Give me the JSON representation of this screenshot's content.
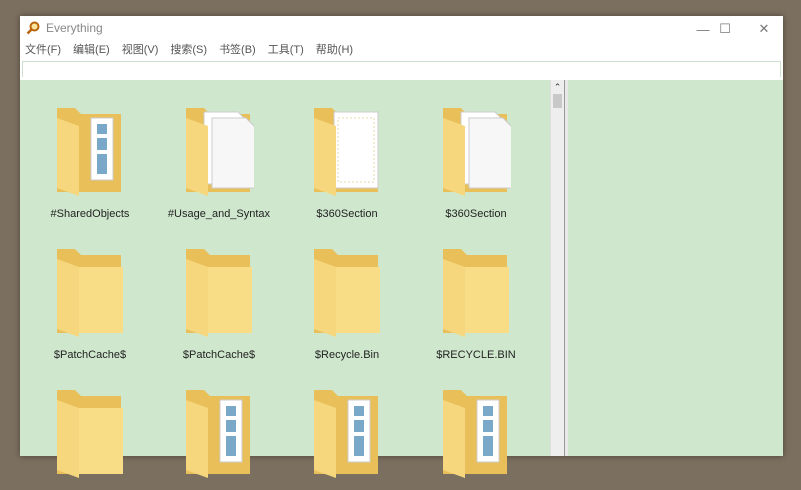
{
  "window": {
    "title": "Everything",
    "minimize": "—",
    "maximize": "☐",
    "close": "✕"
  },
  "menu": [
    "文件(F)",
    "编辑(E)",
    "视图(V)",
    "搜索(S)",
    "书签(B)",
    "工具(T)",
    "帮助(H)"
  ],
  "search": {
    "value": "",
    "placeholder": ""
  },
  "scrollbar": {
    "up_arrow": "⌃"
  },
  "items": [
    {
      "name": "#SharedObjects",
      "icon": "folder-docs"
    },
    {
      "name": "#Usage_and_Syntax",
      "icon": "folder-papers"
    },
    {
      "name": "$360Section",
      "icon": "folder-paper"
    },
    {
      "name": "$360Section",
      "icon": "folder-papers"
    },
    {
      "name": "$PatchCache$",
      "icon": "folder-empty"
    },
    {
      "name": "$PatchCache$",
      "icon": "folder-empty"
    },
    {
      "name": "$Recycle.Bin",
      "icon": "folder-empty"
    },
    {
      "name": "$RECYCLE.BIN",
      "icon": "folder-empty"
    },
    {
      "name": "",
      "icon": "folder-empty"
    },
    {
      "name": "",
      "icon": "folder-docs"
    },
    {
      "name": "",
      "icon": "folder-docs"
    },
    {
      "name": "",
      "icon": "folder-docs"
    }
  ],
  "colors": {
    "background": "#cfe8cd",
    "folder": "#f6d77d",
    "folder_dark": "#e9bf5a"
  }
}
